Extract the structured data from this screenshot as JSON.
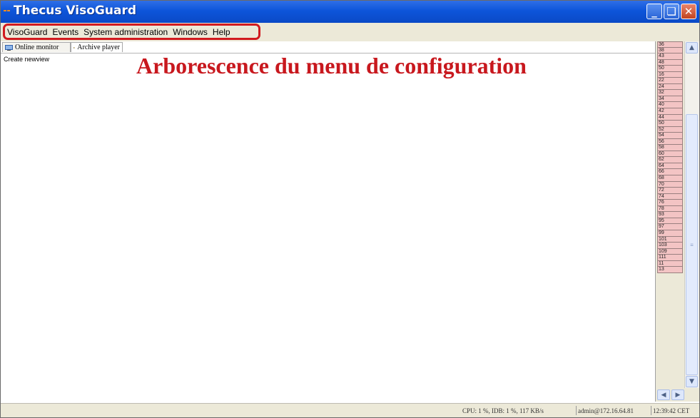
{
  "window": {
    "title": "Thecus VisoGuard",
    "controls": [
      "minimize-icon",
      "restore-icon",
      "close-icon"
    ]
  },
  "menu": {
    "items": [
      "VisoGuard",
      "Events",
      "System administration",
      "Windows",
      "Help"
    ]
  },
  "tabs": [
    {
      "label": "Online monitor",
      "icon": "monitor-icon"
    },
    {
      "label": "Archive player",
      "icon": "player-icon"
    }
  ],
  "view": {
    "create_label": "Create newview"
  },
  "overlay": {
    "heading": "Arborescence du menu de configuration"
  },
  "camera_list": [
    "36",
    "38",
    "43",
    "48",
    "50",
    "16",
    "22",
    "24",
    "32",
    "34",
    "40",
    "42",
    "44",
    "50",
    "52",
    "54",
    "56",
    "58",
    "60",
    "62",
    "64",
    "66",
    "68",
    "70",
    "72",
    "74",
    "76",
    "78",
    "93",
    "95",
    "97",
    "99",
    "101",
    "103",
    "109",
    "111",
    "11",
    "13"
  ],
  "status": {
    "cpu": "CPU: 1 %, IDB: 1 %, 117 KB/s",
    "user": "admin@172.16.64.81",
    "time": "12:39:42 CET"
  },
  "colors": {
    "titlebar": "#0d55da",
    "highlight": "#d11a1f",
    "overlay_text": "#c8181e",
    "camera_cell": "#f3c4c4"
  }
}
